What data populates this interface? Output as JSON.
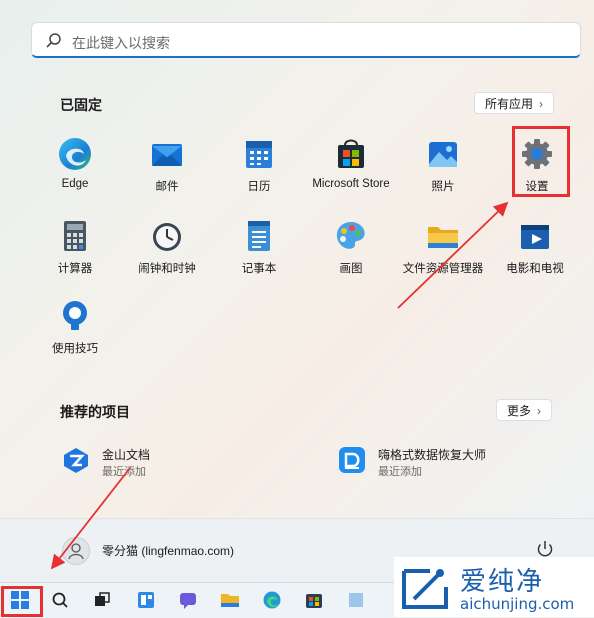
{
  "search": {
    "placeholder": "在此键入以搜索"
  },
  "pinned": {
    "title": "已固定",
    "all_apps_label": "所有应用",
    "apps": [
      {
        "label": "Edge",
        "icon": "edge-icon"
      },
      {
        "label": "邮件",
        "icon": "mail-icon"
      },
      {
        "label": "日历",
        "icon": "calendar-icon"
      },
      {
        "label": "Microsoft Store",
        "icon": "store-icon"
      },
      {
        "label": "照片",
        "icon": "photos-icon"
      },
      {
        "label": "设置",
        "icon": "gear-icon"
      },
      {
        "label": "计算器",
        "icon": "calculator-icon"
      },
      {
        "label": "闹钟和时钟",
        "icon": "clock-icon"
      },
      {
        "label": "记事本",
        "icon": "notepad-icon"
      },
      {
        "label": "画图",
        "icon": "paint-icon"
      },
      {
        "label": "文件资源管理器",
        "icon": "folder-icon"
      },
      {
        "label": "电影和电视",
        "icon": "movies-icon"
      },
      {
        "label": "使用技巧",
        "icon": "tips-icon"
      }
    ]
  },
  "recommended": {
    "title": "推荐的项目",
    "more_label": "更多",
    "items": [
      {
        "title": "金山文档",
        "subtitle": "最近添加",
        "icon": "kingsoft-docs-icon"
      },
      {
        "title": "嗨格式数据恢复大师",
        "subtitle": "最近添加",
        "icon": "data-recovery-icon"
      }
    ]
  },
  "user": {
    "name": "零分猫 (lingfenmao.com)"
  },
  "watermark": {
    "cn": "爱纯净",
    "en": "aichunjing.com"
  },
  "colors": {
    "accent": "#1f6fc9",
    "highlight": "#e53131"
  }
}
